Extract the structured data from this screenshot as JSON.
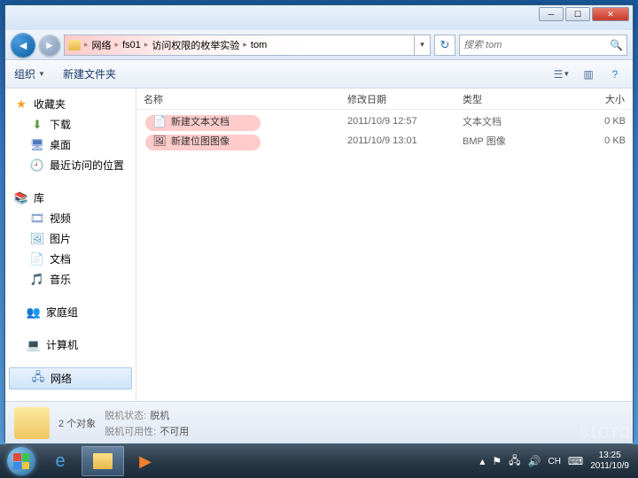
{
  "breadcrumb": {
    "segments": [
      "网络",
      "fs01",
      "访问权限的枚举实验",
      "tom"
    ]
  },
  "search": {
    "placeholder": "搜索 tom"
  },
  "toolbar": {
    "organize": "组织",
    "new_folder": "新建文件夹"
  },
  "sidebar": {
    "favorites": {
      "label": "收藏夹",
      "items": [
        "下载",
        "桌面",
        "最近访问的位置"
      ]
    },
    "libraries": {
      "label": "库",
      "items": [
        "视频",
        "图片",
        "文档",
        "音乐"
      ]
    },
    "homegroup": {
      "label": "家庭组"
    },
    "computer": {
      "label": "计算机"
    },
    "network": {
      "label": "网络"
    }
  },
  "columns": {
    "name": "名称",
    "date": "修改日期",
    "type": "类型",
    "size": "大小"
  },
  "files": [
    {
      "name": "新建文本文档",
      "date": "2011/10/9 12:57",
      "type": "文本文档",
      "size": "0 KB",
      "icon": "📄"
    },
    {
      "name": "新建位图图像",
      "date": "2011/10/9 13:01",
      "type": "BMP 图像",
      "size": "0 KB",
      "icon": "🖼"
    }
  ],
  "status": {
    "count": "2 个对象",
    "offline_label": "脱机状态:",
    "offline_value": "脱机",
    "avail_label": "脱机可用性:",
    "avail_value": "不可用"
  },
  "tray": {
    "ime": "CH",
    "time": "13:25",
    "date": "2011/10/9"
  }
}
